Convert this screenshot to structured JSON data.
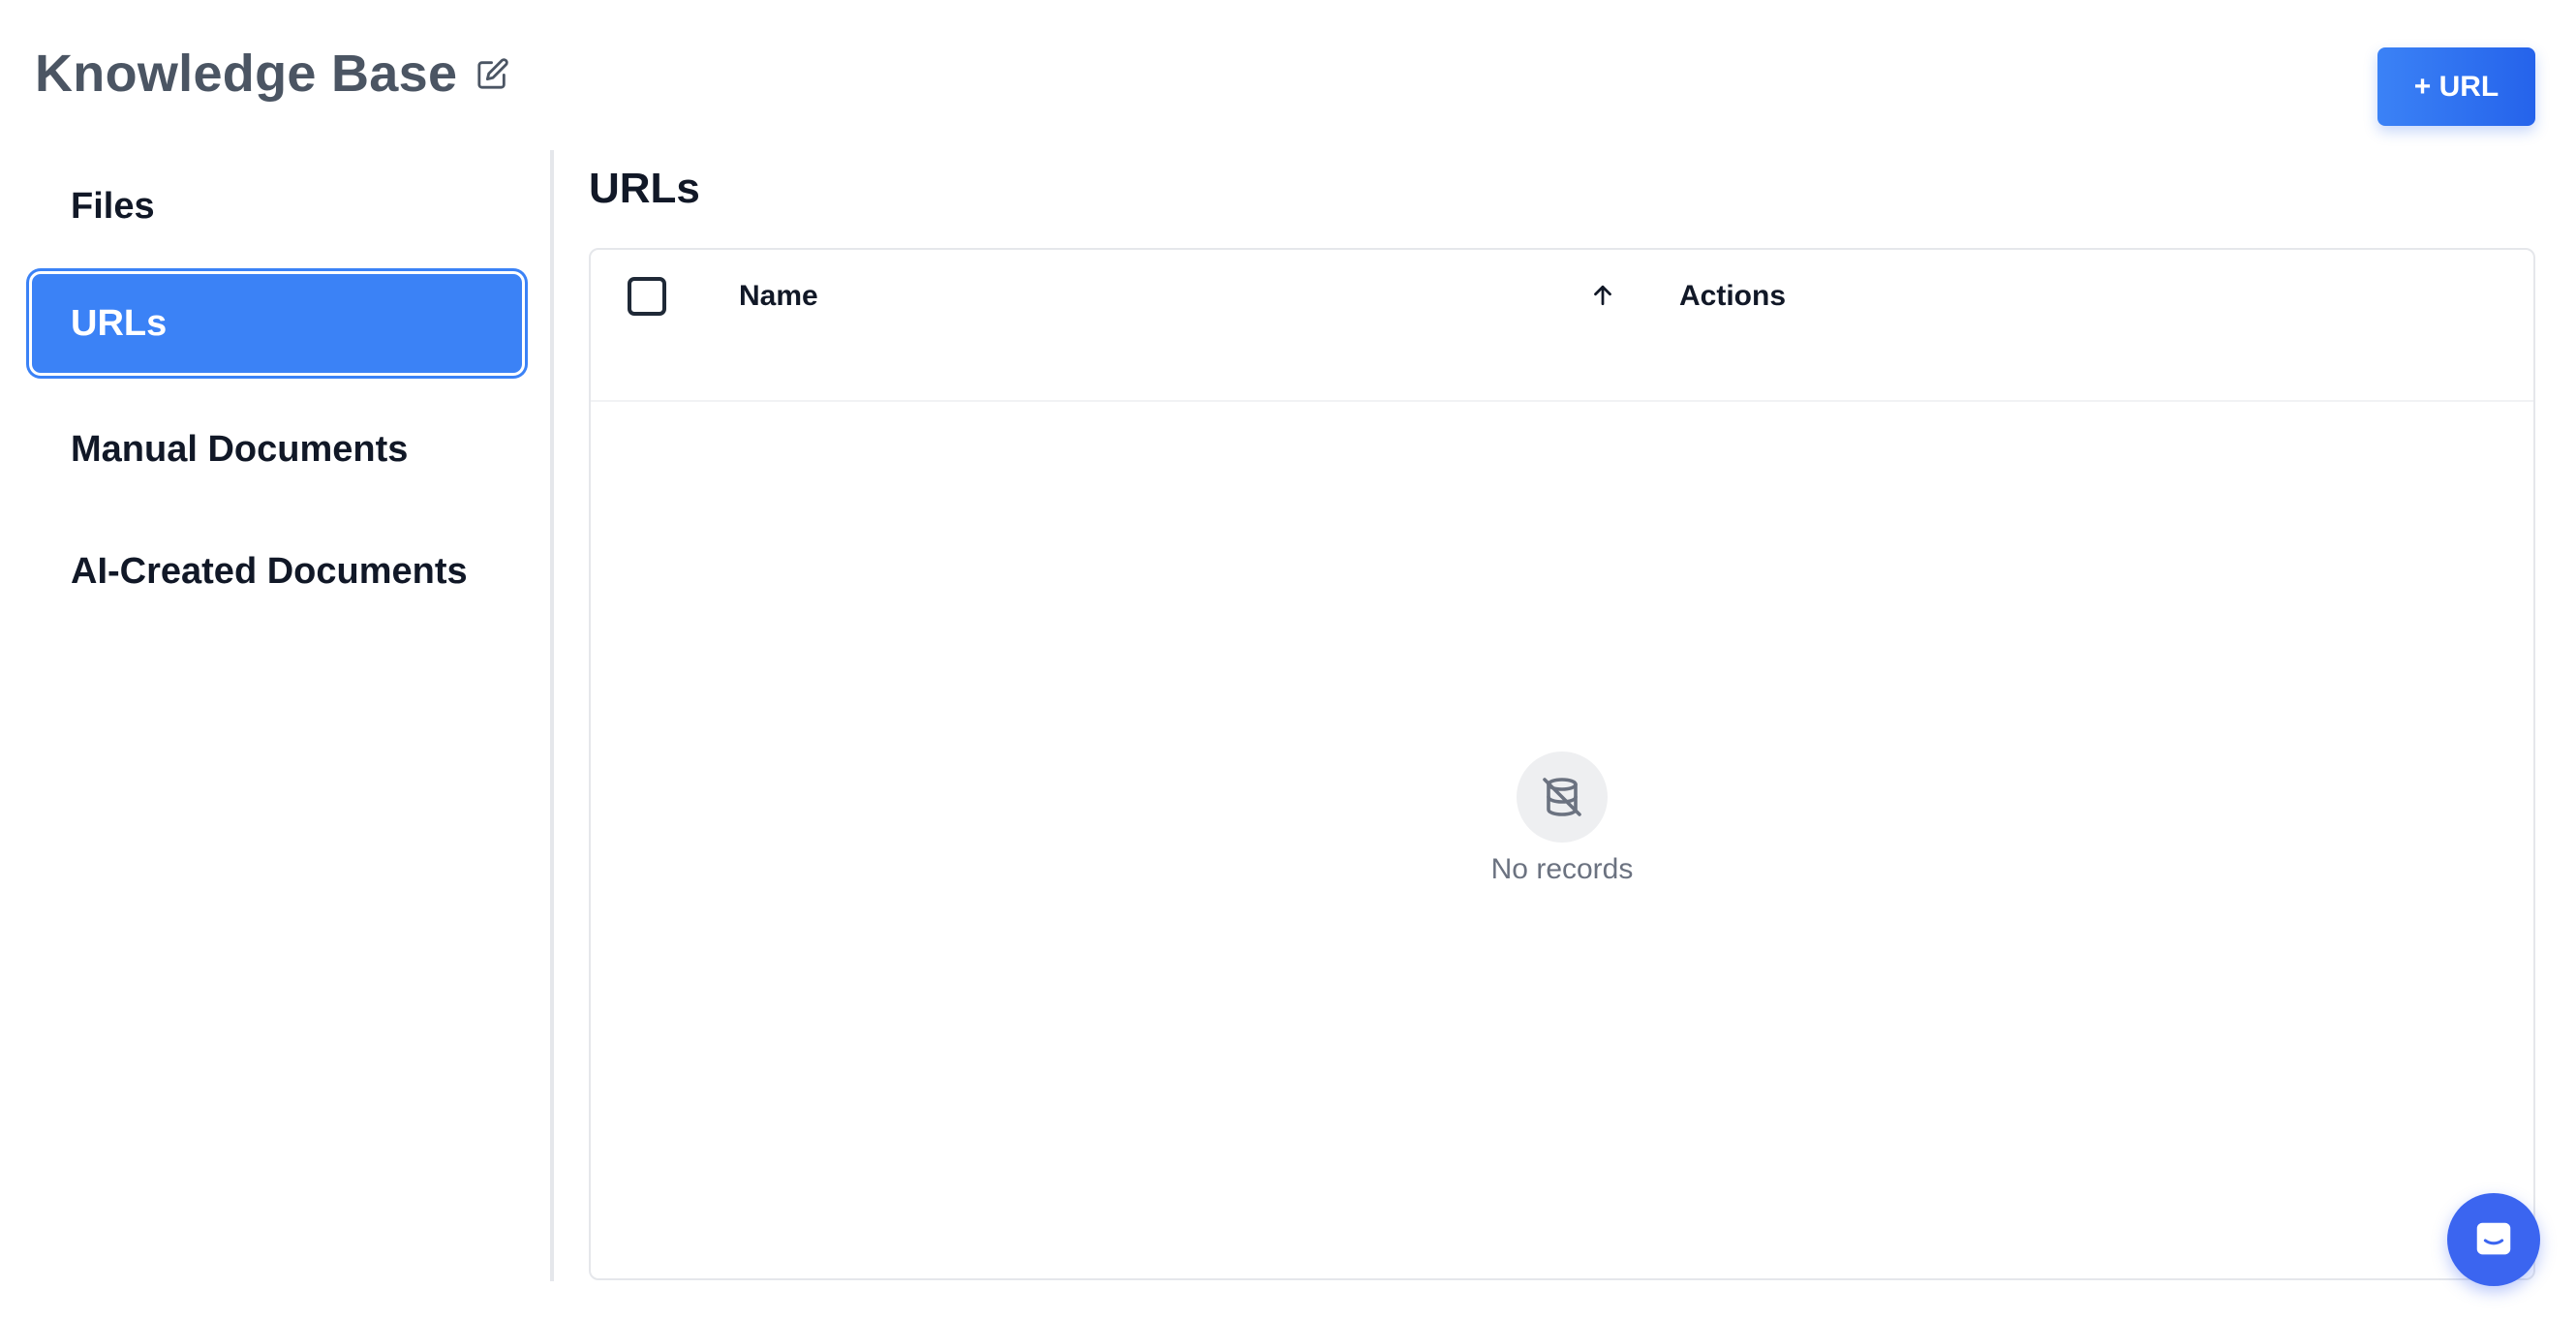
{
  "header": {
    "title": "Knowledge Base",
    "edit_icon": "pencil-edit-icon",
    "add_button_label": "+ URL"
  },
  "sidebar": {
    "items": [
      {
        "label": "Files",
        "active": false
      },
      {
        "label": "URLs",
        "active": true
      },
      {
        "label": "Manual Documents",
        "active": false
      },
      {
        "label": "AI-Created Documents",
        "active": false
      }
    ]
  },
  "main": {
    "section_title": "URLs",
    "table": {
      "columns": [
        {
          "label": "Name",
          "sort": "ascending"
        },
        {
          "label": "Actions"
        }
      ],
      "rows": [],
      "empty_text": "No records",
      "empty_icon": "database-off-icon"
    }
  },
  "chat_launcher": {
    "icon": "chat-icon"
  },
  "colors": {
    "accent": "#3b82f6",
    "title_gray": "#4b5563",
    "text": "#111827",
    "muted": "#6b7280",
    "border": "#e5e7eb",
    "chat": "#3b65f0"
  }
}
